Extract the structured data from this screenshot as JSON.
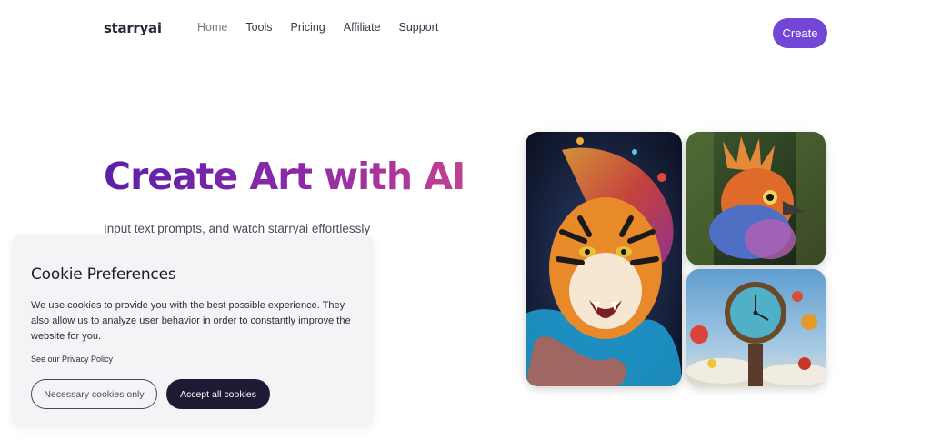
{
  "header": {
    "logo": "starryai",
    "nav": [
      "Home",
      "Tools",
      "Pricing",
      "Affiliate",
      "Support"
    ],
    "active_nav": "Home",
    "cta_label": "Create",
    "cta_color": "#7346d6"
  },
  "hero": {
    "title": "Create Art with AI",
    "subtitle": "Input text prompts, and watch starryai effortlessly"
  },
  "gallery": {
    "images": [
      "tiger-artwork",
      "bird-artwork",
      "clock-artwork"
    ]
  },
  "cookie": {
    "title": "Cookie Preferences",
    "text": "We use cookies to provide you with the best possible experience. They also allow us to analyze user behavior in order to constantly improve the website for you.",
    "policy_link": "See our Privacy Policy",
    "necessary_label": "Necessary cookies only",
    "accept_label": "Accept all cookies"
  }
}
